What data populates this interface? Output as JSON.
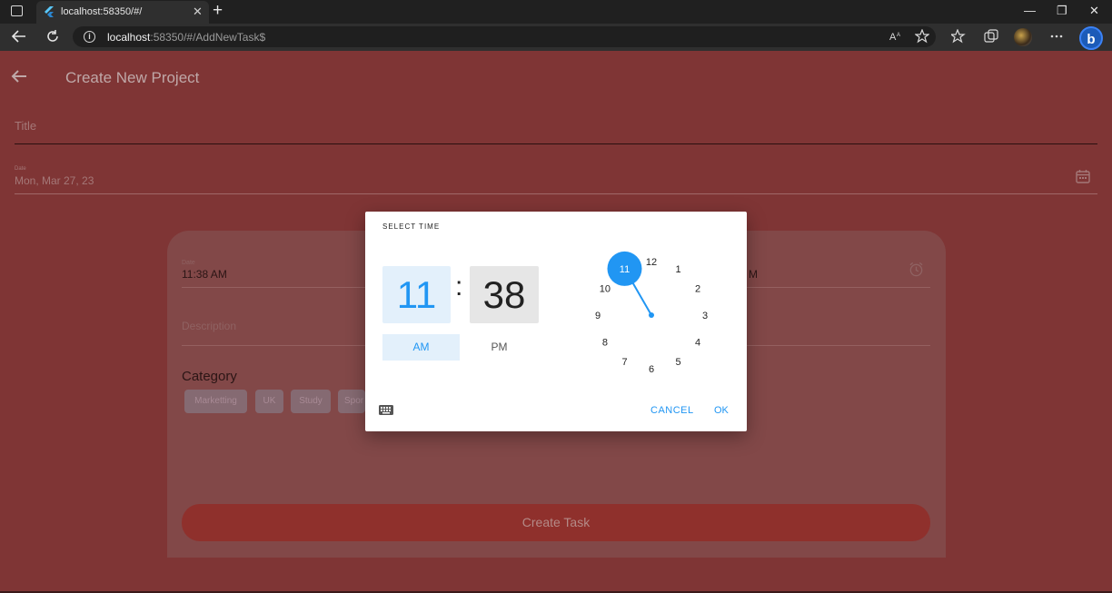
{
  "browser": {
    "tab_title": "localhost:58350/#/",
    "tab_close": "✕",
    "new_tab": "+",
    "url_host": "localhost",
    "url_path": ":58350/#/AddNewTask$",
    "minimize": "—",
    "maximize": "❐",
    "close": "✕"
  },
  "app": {
    "page_title": "Create New Project",
    "title_label": "Title",
    "date_label": "Date",
    "date_value": "Mon, Mar 27, 23",
    "card": {
      "start_label": "Date",
      "start_value": "11:38 AM",
      "end_fragment": "M",
      "description_label": "Description",
      "category_label": "Category",
      "chips": [
        "Marketting",
        "UK",
        "Study",
        "Spor"
      ],
      "create_button": "Create Task"
    }
  },
  "dialog": {
    "heading": "SELECT TIME",
    "hour": "11",
    "colon": ":",
    "minute": "38",
    "am": "AM",
    "pm": "PM",
    "selected_period": "AM",
    "clock_numbers": [
      "12",
      "1",
      "2",
      "3",
      "4",
      "5",
      "6",
      "7",
      "8",
      "9",
      "10",
      "11"
    ],
    "selected_hour": "11",
    "cancel": "CANCEL",
    "ok": "OK",
    "accent_color": "#2196f3"
  }
}
